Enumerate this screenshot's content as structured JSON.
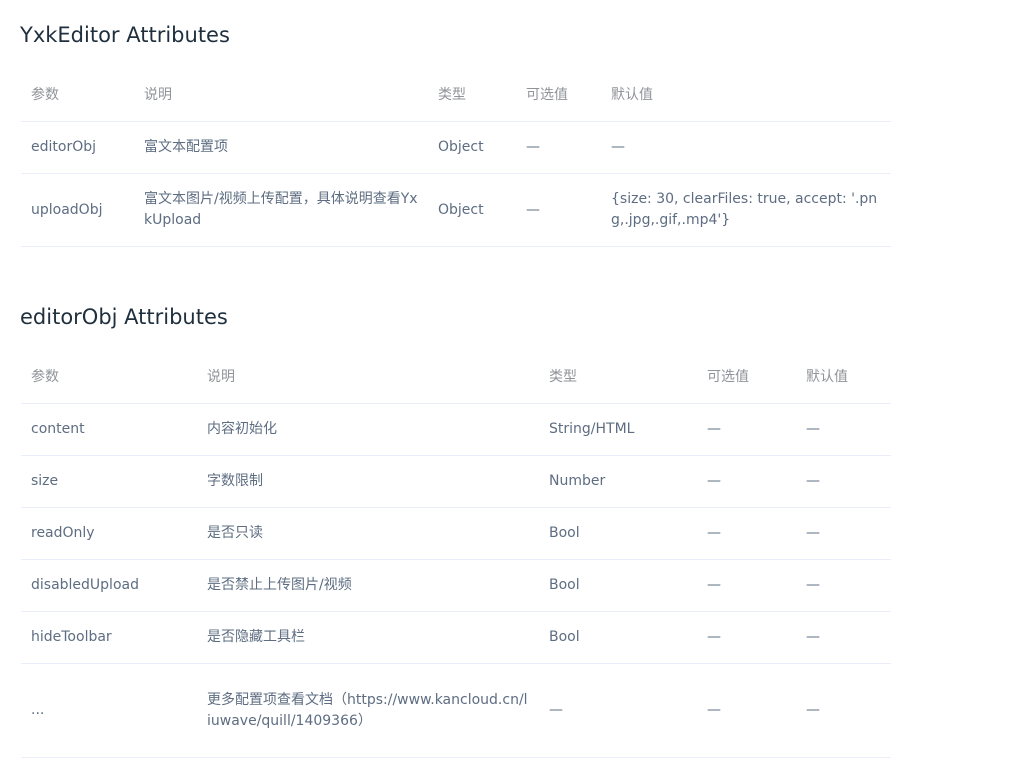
{
  "sections": [
    {
      "title": "YxkEditor Attributes",
      "headers": [
        "参数",
        "说明",
        "类型",
        "可选值",
        "默认值"
      ],
      "rows": [
        [
          "editorObj",
          "富文本配置项",
          "Object",
          "—",
          "—"
        ],
        [
          "uploadObj",
          "富文本图片/视频上传配置，具体说明查看YxkUpload",
          "Object",
          "—",
          "{size: 30, clearFiles: true, accept: '.png,.jpg,.gif,.mp4'}"
        ]
      ]
    },
    {
      "title": "editorObj Attributes",
      "headers": [
        "参数",
        "说明",
        "类型",
        "可选值",
        "默认值"
      ],
      "rows": [
        [
          "content",
          "内容初始化",
          "String/HTML",
          "—",
          "—"
        ],
        [
          "size",
          "字数限制",
          "Number",
          "—",
          "—"
        ],
        [
          "readOnly",
          "是否只读",
          "Bool",
          "—",
          "—"
        ],
        [
          "disabledUpload",
          "是否禁止上传图片/视频",
          "Bool",
          "—",
          "—"
        ],
        [
          "hideToolbar",
          "是否隐藏工具栏",
          "Bool",
          "—",
          "—"
        ],
        [
          "...",
          "更多配置项查看文档（https://www.kancloud.cn/liuwave/quill/1409366）",
          "—",
          "—",
          "—"
        ]
      ]
    }
  ]
}
